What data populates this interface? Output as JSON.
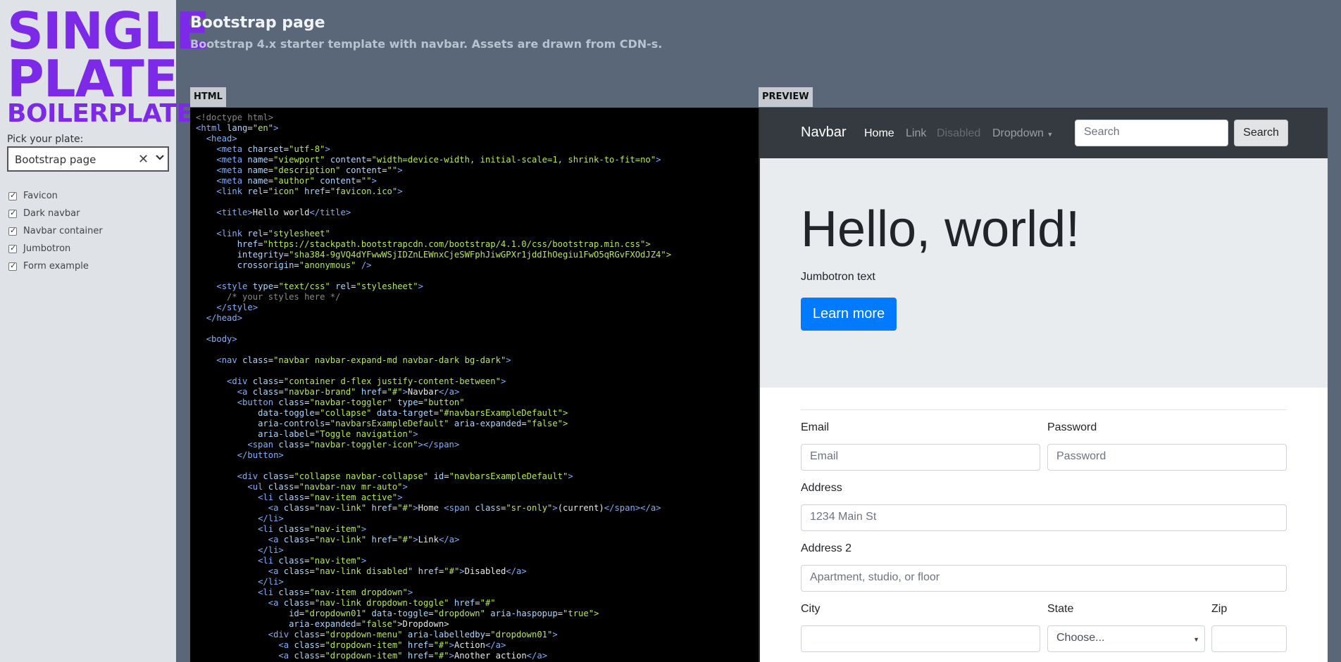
{
  "sidebar": {
    "logo": {
      "line1": "SINGLE",
      "line2": "PLATE",
      "line3": "BOILERPLATE"
    },
    "pick_label": "Pick your plate:",
    "select_value": "Bootstrap page",
    "options": [
      "Favicon",
      "Dark navbar",
      "Navbar container",
      "Jumbotron",
      "Form example"
    ]
  },
  "header": {
    "title": "Bootstrap page",
    "subtitle": "Bootstrap 4.x starter template with navbar. Assets are drawn from CDN-s."
  },
  "panels": {
    "code_label": "HTML",
    "preview_label": "PREVIEW"
  },
  "code_lines": [
    "<!doctype html>",
    "<html lang=\"en\">",
    "  <head>",
    "    <meta charset=\"utf-8\">",
    "    <meta name=\"viewport\" content=\"width=device-width, initial-scale=1, shrink-to-fit=no\">",
    "    <meta name=\"description\" content=\"\">",
    "    <meta name=\"author\" content=\"\">",
    "    <link rel=\"icon\" href=\"favicon.ico\">",
    "",
    "    <title>Hello world</title>",
    "",
    "    <link rel=\"stylesheet\"",
    "        href=\"https://stackpath.bootstrapcdn.com/bootstrap/4.1.0/css/bootstrap.min.css\"",
    "        integrity=\"sha384-9gVQ4dYFwwWSjIDZnLEWnxCjeSWFphJiwGPXr1jddIhOegiu1FwO5qRGvFXOdJZ4\"",
    "        crossorigin=\"anonymous\" />",
    "",
    "    <style type=\"text/css\" rel=\"stylesheet\">",
    "      /* your styles here */",
    "    </style>",
    "  </head>",
    "",
    "  <body>",
    "",
    "    <nav class=\"navbar navbar-expand-md navbar-dark bg-dark\">",
    "",
    "      <div class=\"container d-flex justify-content-between\">",
    "        <a class=\"navbar-brand\" href=\"#\">Navbar</a>",
    "        <button class=\"navbar-toggler\" type=\"button\"",
    "            data-toggle=\"collapse\" data-target=\"#navbarsExampleDefault\"",
    "            aria-controls=\"navbarsExampleDefault\" aria-expanded=\"false\"",
    "            aria-label=\"Toggle navigation\">",
    "          <span class=\"navbar-toggler-icon\"></span>",
    "        </button>",
    "",
    "        <div class=\"collapse navbar-collapse\" id=\"navbarsExampleDefault\">",
    "          <ul class=\"navbar-nav mr-auto\">",
    "            <li class=\"nav-item active\">",
    "              <a class=\"nav-link\" href=\"#\">Home <span class=\"sr-only\">(current)</span></a>",
    "            </li>",
    "            <li class=\"nav-item\">",
    "              <a class=\"nav-link\" href=\"#\">Link</a>",
    "            </li>",
    "            <li class=\"nav-item\">",
    "              <a class=\"nav-link disabled\" href=\"#\">Disabled</a>",
    "            </li>",
    "            <li class=\"nav-item dropdown\">",
    "              <a class=\"nav-link dropdown-toggle\" href=\"#\"",
    "                  id=\"dropdown01\" data-toggle=\"dropdown\" aria-haspopup=\"true\"",
    "                  aria-expanded=\"false\">Dropdown</a>",
    "              <div class=\"dropdown-menu\" aria-labelledby=\"dropdown01\">",
    "                <a class=\"dropdown-item\" href=\"#\">Action</a>",
    "                <a class=\"dropdown-item\" href=\"#\">Another action</a>"
  ],
  "preview": {
    "navbar": {
      "brand": "Navbar",
      "links": [
        "Home",
        "Link",
        "Disabled",
        "Dropdown"
      ],
      "search_placeholder": "Search",
      "search_button": "Search"
    },
    "jumbotron": {
      "heading": "Hello, world!",
      "text": "Jumbotron text",
      "button": "Learn more"
    },
    "form": {
      "email_label": "Email",
      "email_placeholder": "Email",
      "password_label": "Password",
      "password_placeholder": "Password",
      "address_label": "Address",
      "address_placeholder": "1234 Main St",
      "address2_label": "Address 2",
      "address2_placeholder": "Apartment, studio, or floor",
      "city_label": "City",
      "state_label": "State",
      "state_value": "Choose...",
      "zip_label": "Zip"
    }
  },
  "colors": {
    "logo": "#7d2ae8",
    "background": "#5a6778",
    "primary": "#007bff",
    "navbar": "#343a40"
  }
}
